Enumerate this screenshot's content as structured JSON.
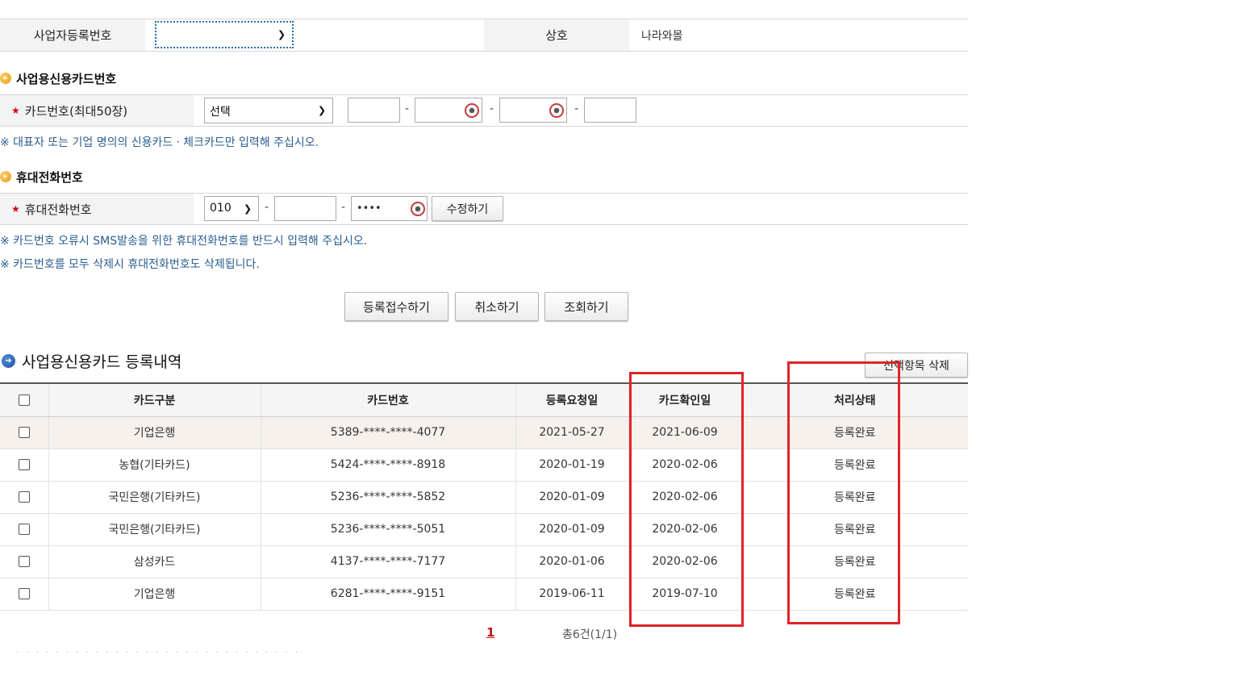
{
  "business": {
    "reg_label": "사업자등록번호",
    "reg_value": "",
    "name_label": "상호",
    "name_value": "나라와몰"
  },
  "card_section": {
    "title": "사업용신용카드번호",
    "field_label": "카드번호(최대50장)",
    "select_value": "선택",
    "note": "※ 대표자 또는 기업 명의의 신용카드ㆍ체크카드만 입력해 주십시오."
  },
  "phone_section": {
    "title": "휴대전화번호",
    "field_label": "휴대전화번호",
    "prefix_value": "010",
    "middle_value": "",
    "last_value": "••••",
    "edit_button": "수정하기",
    "note1": "※ 카드번호 오류시 SMS발송을 위한 휴대전화번호를 반드시 입력해 주십시오.",
    "note2": "※ 카드번호를 모두 삭제시 휴대전화번호도 삭제됩니다."
  },
  "actions": {
    "register": "등록접수하기",
    "cancel": "취소하기",
    "lookup": "조회하기"
  },
  "history": {
    "title": "사업용신용카드 등록내역",
    "delete_button": "선택항목 삭제",
    "columns": [
      "카드구분",
      "카드번호",
      "등록요청일",
      "카드확인일",
      "처리상태"
    ],
    "rows": [
      {
        "type": "기업은행",
        "number": "5389-****-****-4077",
        "request": "2021-05-27",
        "confirm": "2021-06-09",
        "status": "등록완료"
      },
      {
        "type": "농협(기타카드)",
        "number": "5424-****-****-8918",
        "request": "2020-01-19",
        "confirm": "2020-02-06",
        "status": "등록완료"
      },
      {
        "type": "국민은행(기타카드)",
        "number": "5236-****-****-5852",
        "request": "2020-01-09",
        "confirm": "2020-02-06",
        "status": "등록완료"
      },
      {
        "type": "국민은행(기타카드)",
        "number": "5236-****-****-5051",
        "request": "2020-01-09",
        "confirm": "2020-02-06",
        "status": "등록완료"
      },
      {
        "type": "삼성카드",
        "number": "4137-****-****-7177",
        "request": "2020-01-06",
        "confirm": "2020-02-06",
        "status": "등록완료"
      },
      {
        "type": "기업은행",
        "number": "6281-****-****-9151",
        "request": "2019-06-11",
        "confirm": "2019-07-10",
        "status": "등록완료"
      }
    ],
    "page_current": "1",
    "total": "총6건(1/1)"
  },
  "colors": {
    "highlight_box": "#e0232b",
    "note_text": "#2a5d8f",
    "required_star": "#d0021b"
  }
}
